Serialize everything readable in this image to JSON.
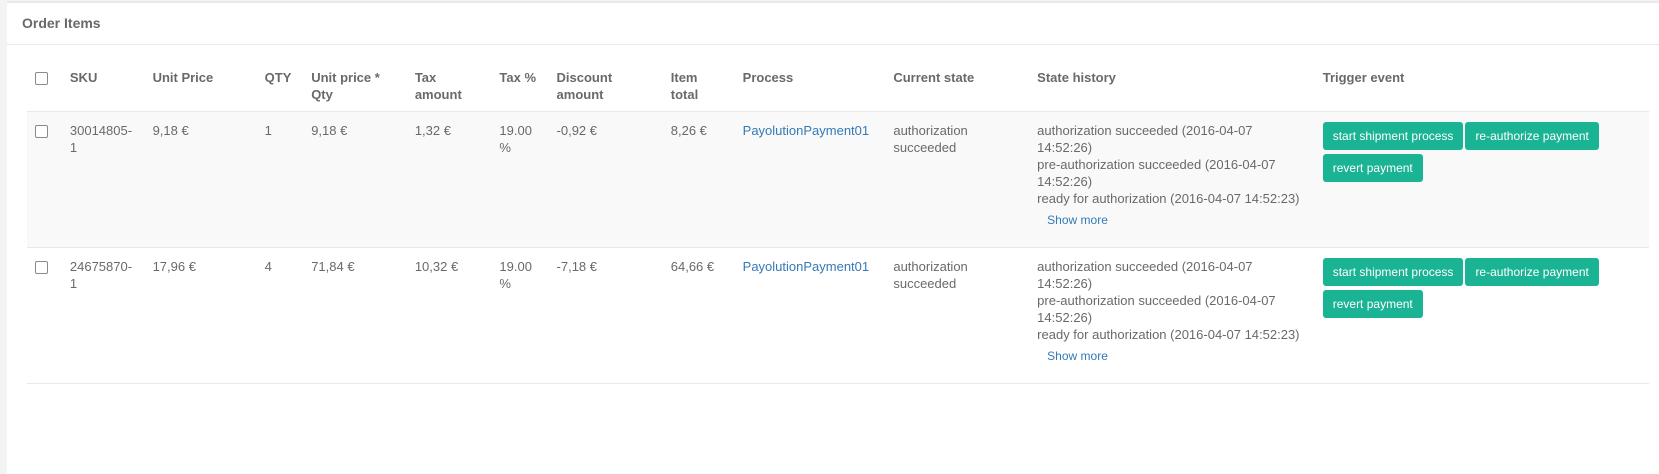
{
  "panel": {
    "title": "Order Items"
  },
  "table": {
    "headers": {
      "sku": "SKU",
      "unit_price": "Unit Price",
      "qty": "QTY",
      "unit_price_qty": "Unit price * Qty",
      "tax_amount": "Tax amount",
      "tax_percent": "Tax %",
      "discount_amount": "Discount amount",
      "item_total": "Item total",
      "process": "Process",
      "current_state": "Current state",
      "state_history": "State history",
      "trigger_event": "Trigger event"
    },
    "rows": [
      {
        "sku": "30014805-1",
        "unit_price": "9,18 €",
        "qty": "1",
        "unit_price_qty": "9,18 €",
        "tax_amount": "1,32 €",
        "tax_percent": "19.00 %",
        "discount_amount": "-0,92 €",
        "item_total": "8,26 €",
        "process": "PayolutionPayment01",
        "current_state": "authorization succeeded",
        "history": [
          "authorization succeeded (2016-04-07 14:52:26)",
          "pre-authorization succeeded (2016-04-07 14:52:26)",
          "ready for authorization (2016-04-07 14:52:23)"
        ],
        "show_more": "Show more",
        "buttons": [
          "start shipment process",
          "re-authorize payment",
          "revert payment"
        ]
      },
      {
        "sku": "24675870-1",
        "unit_price": "17,96 €",
        "qty": "4",
        "unit_price_qty": "71,84 €",
        "tax_amount": "10,32 €",
        "tax_percent": "19.00 %",
        "discount_amount": "-7,18 €",
        "item_total": "64,66 €",
        "process": "PayolutionPayment01",
        "current_state": "authorization succeeded",
        "history": [
          "authorization succeeded (2016-04-07 14:52:26)",
          "pre-authorization succeeded (2016-04-07 14:52:26)",
          "ready for authorization (2016-04-07 14:52:23)"
        ],
        "show_more": "Show more",
        "buttons": [
          "start shipment process",
          "re-authorize payment",
          "revert payment"
        ]
      }
    ]
  },
  "colors": {
    "accent_button": "#1ab394",
    "link": "#337ab7",
    "row_striped": "#f9f9f9"
  }
}
